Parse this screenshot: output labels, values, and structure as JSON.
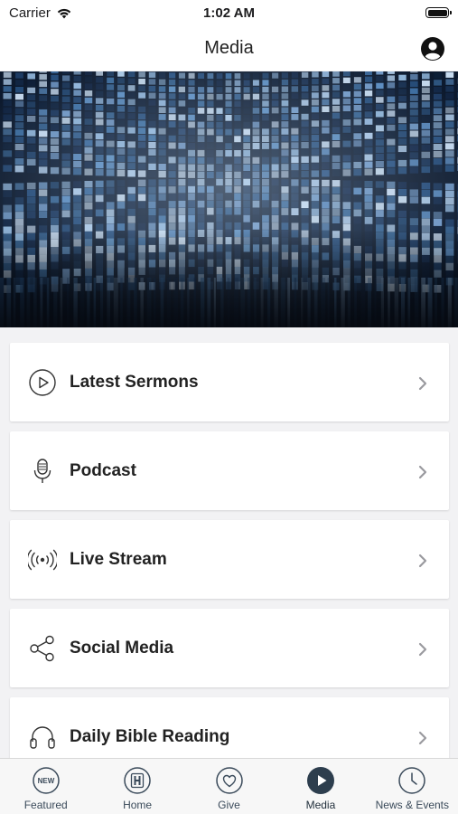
{
  "status": {
    "carrier": "Carrier",
    "time": "1:02 AM"
  },
  "header": {
    "title": "Media"
  },
  "menu": [
    {
      "label": "Latest Sermons",
      "icon": "play-circle-icon"
    },
    {
      "label": "Podcast",
      "icon": "microphone-icon"
    },
    {
      "label": "Live Stream",
      "icon": "broadcast-icon"
    },
    {
      "label": "Social Media",
      "icon": "share-icon"
    },
    {
      "label": "Daily Bible Reading",
      "icon": "headphones-icon"
    }
  ],
  "tabs": [
    {
      "label": "Featured",
      "icon": "new-badge-icon",
      "badge_text": "NEW"
    },
    {
      "label": "Home",
      "icon": "home-h-icon"
    },
    {
      "label": "Give",
      "icon": "heart-icon"
    },
    {
      "label": "Media",
      "icon": "play-icon",
      "active": true
    },
    {
      "label": "News & Events",
      "icon": "clock-icon"
    }
  ],
  "colors": {
    "accent": "#2d3e4e",
    "background": "#f2f2f4"
  }
}
